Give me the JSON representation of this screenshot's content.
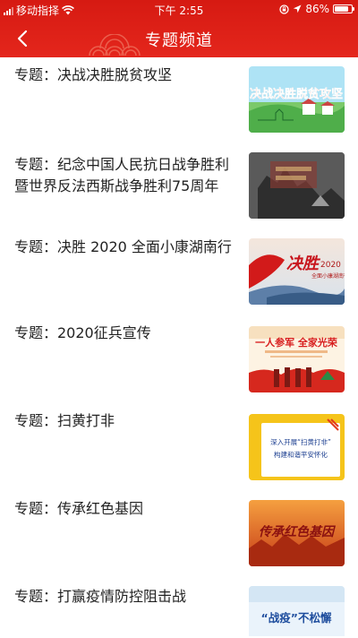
{
  "status_bar": {
    "carrier": "移动指择",
    "time": "下午 2:55",
    "battery": "86%",
    "battery_level": 0.86
  },
  "nav": {
    "title": "专题频道",
    "back_icon": "chevron-left-icon"
  },
  "topics": [
    {
      "title": "专题：决战决胜脱贫攻坚",
      "thumb_text": "决战决胜脱贫攻坚"
    },
    {
      "title": "专题：纪念中国人民抗日战争胜利暨世界反法西斯战争胜利75周年",
      "thumb_text": ""
    },
    {
      "title": "专题：决胜 2020 全面小康湖南行",
      "thumb_text_main": "决胜",
      "thumb_text_year": "2020",
      "thumb_text_sub": "全面小康湖南行"
    },
    {
      "title": "专题：2020征兵宣传",
      "thumb_text": "一人参军 全家光荣"
    },
    {
      "title": "专题：扫黄打非",
      "thumb_line1": "深入开展“扫黄打非”",
      "thumb_line2": "构建和谐平安怀化"
    },
    {
      "title": "专题：传承红色基因",
      "thumb_text": "传承红色基因"
    },
    {
      "title": "专题：打赢疫情防控阻击战",
      "thumb_text": "“战疫”不松懈"
    }
  ],
  "colors": {
    "header_red": "#e4261c",
    "text": "#222222"
  }
}
